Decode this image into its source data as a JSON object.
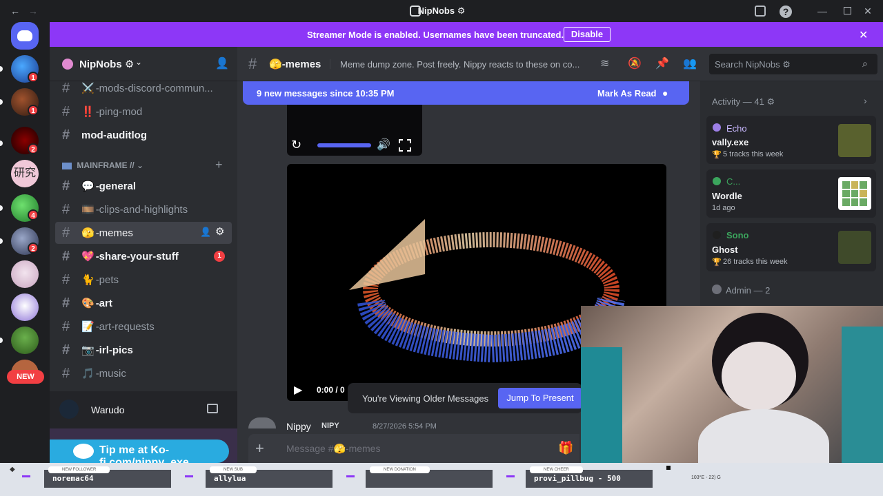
{
  "window": {
    "title": "NipNobs ⚙"
  },
  "banner": {
    "text": "Streamer Mode is enabled. Usernames have been truncated.",
    "button": "Disable"
  },
  "server": {
    "name": "NipNobs ⚙"
  },
  "channels": [
    {
      "name": "-mods-discord-commun...",
      "emoji": "⚔️"
    },
    {
      "name": "-ping-mod",
      "emoji": "‼️"
    },
    {
      "name": "mod-auditlog",
      "emoji": ""
    }
  ],
  "category": {
    "name": "MAINFRAME //"
  },
  "main_channels": [
    {
      "name": "-general",
      "emoji": "💬"
    },
    {
      "name": "-clips-and-highlights",
      "emoji": "🎞️"
    },
    {
      "name": "-memes",
      "emoji": "🫣"
    },
    {
      "name": "-share-your-stuff",
      "emoji": "💖",
      "badge": "1"
    },
    {
      "name": "-pets",
      "emoji": "🐈"
    },
    {
      "name": "-art",
      "emoji": "🎨"
    },
    {
      "name": "-art-requests",
      "emoji": "📝"
    },
    {
      "name": "-irl-pics",
      "emoji": "📷"
    },
    {
      "name": "-music",
      "emoji": "🎵"
    }
  ],
  "voice": {
    "name": "Warudo"
  },
  "kofi": {
    "text": "Tip me at Ko-fi.com/nippy_exe"
  },
  "servers_badges": [
    "1",
    "1",
    "2",
    "2",
    "4",
    "2"
  ],
  "new_badge": "NEW",
  "topbar": {
    "channel": "-memes",
    "topic": "Meme dump zone. Post freely. Nippy reacts to these on co...",
    "search_placeholder": "Search NipNobs ⚙"
  },
  "new_messages": {
    "text": "9 new messages since 10:35 PM",
    "action": "Mark As Read"
  },
  "video": {
    "time": "0:00 / 0"
  },
  "older": {
    "text": "You're Viewing Older Messages",
    "button": "Jump To Present"
  },
  "message": {
    "author": "Nippy",
    "tag": "NIPY",
    "timestamp": "8/27/2026 5:54 PM"
  },
  "composer": {
    "placeholder": "Message #🫣-memes"
  },
  "activity": {
    "header": "Activity — 41 ⚙",
    "cards": [
      {
        "user": "Echo",
        "title": "vally.exe",
        "sub": "5 tracks this week",
        "color": "#9d7fe6"
      },
      {
        "user": "C...",
        "title": "Wordle",
        "sub": "1d ago",
        "color": "#3ba55d"
      },
      {
        "user": "Sono",
        "title": "Ghost",
        "sub": "26 tracks this week",
        "color": "#3ba55d"
      }
    ],
    "admin_header": "Admin — 2"
  },
  "alerts": [
    {
      "label": "NEW FOLLOWER",
      "value": "noremac64"
    },
    {
      "label": "NEW SUB",
      "value": "allylua"
    },
    {
      "label": "NEW DONATION",
      "value": ""
    },
    {
      "label": "NEW CHEER",
      "value": "provi_pillbug - 500"
    }
  ],
  "hud": {
    "readout": "103°E - 22) G"
  }
}
